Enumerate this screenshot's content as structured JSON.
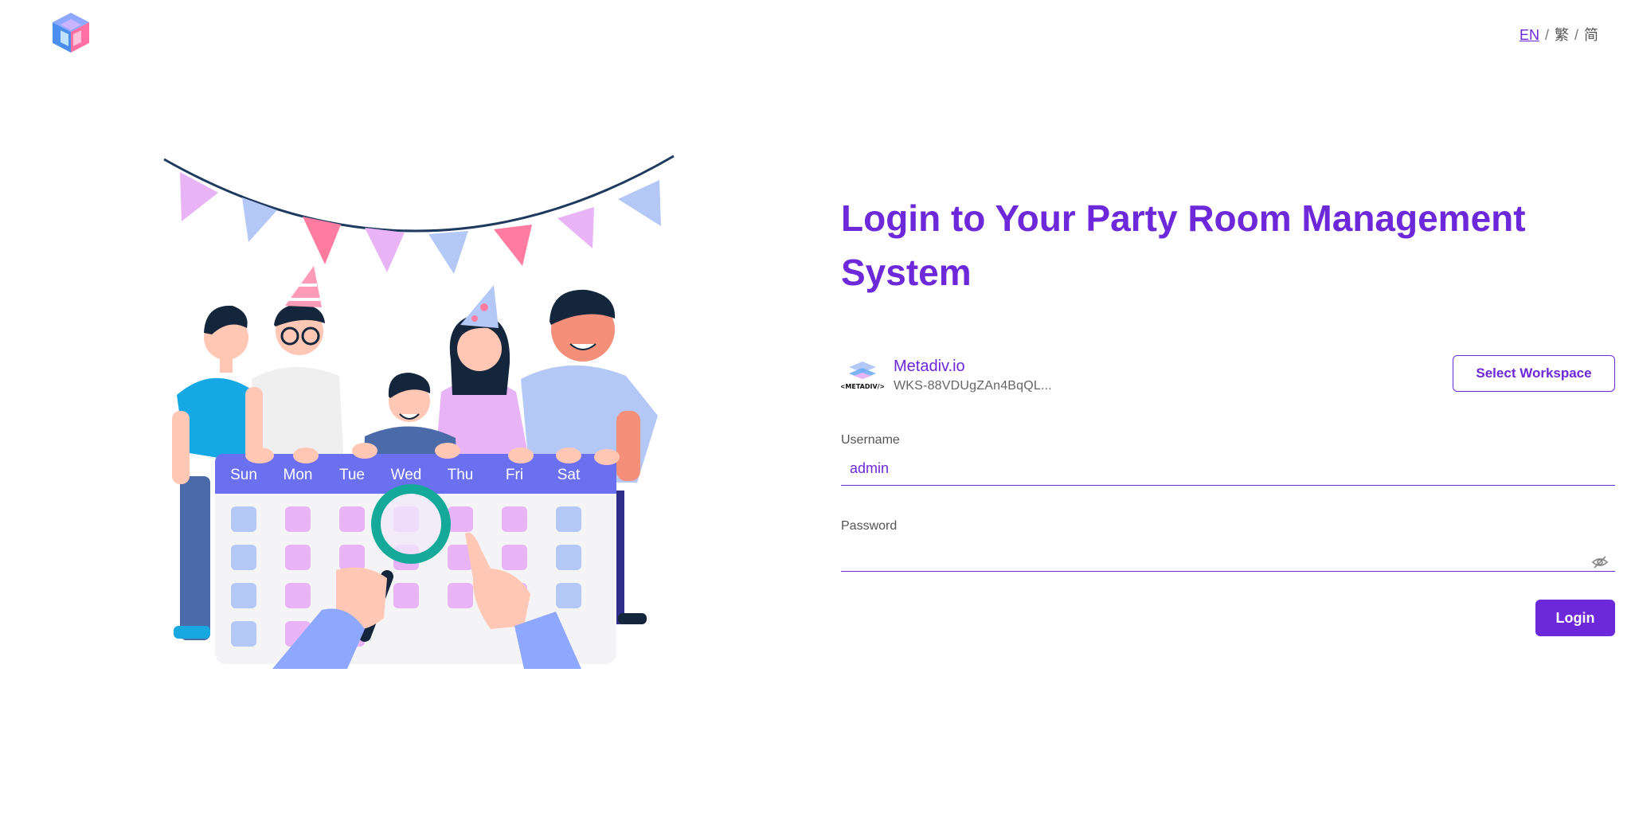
{
  "header": {
    "logo_icon": "cube-logo-icon",
    "languages": [
      {
        "label": "EN",
        "active": true
      },
      {
        "label": "繁",
        "active": false
      },
      {
        "label": "简",
        "active": false
      }
    ],
    "separator": "/"
  },
  "illustration": {
    "calendar_days": [
      "Sun",
      "Mon",
      "Tue",
      "Wed",
      "Thu",
      "Fri",
      "Sat"
    ]
  },
  "login": {
    "title": "Login to Your Party Room Management System",
    "workspace": {
      "logo_text": "<METADIV/>",
      "name": "Metadiv.io",
      "id": "WKS-88VDUgZAn4BqQL...",
      "select_label": "Select Workspace"
    },
    "username": {
      "label": "Username",
      "value": "admin"
    },
    "password": {
      "label": "Password",
      "value": "",
      "toggle_icon": "eye-off-icon"
    },
    "submit_label": "Login"
  },
  "colors": {
    "accent": "#6d28d9",
    "calendar_header": "#6a70f0",
    "pink": "#ff7ca0",
    "lilac": "#e8b4f6",
    "blue": "#b4c8f8",
    "teal": "#15a99a"
  }
}
